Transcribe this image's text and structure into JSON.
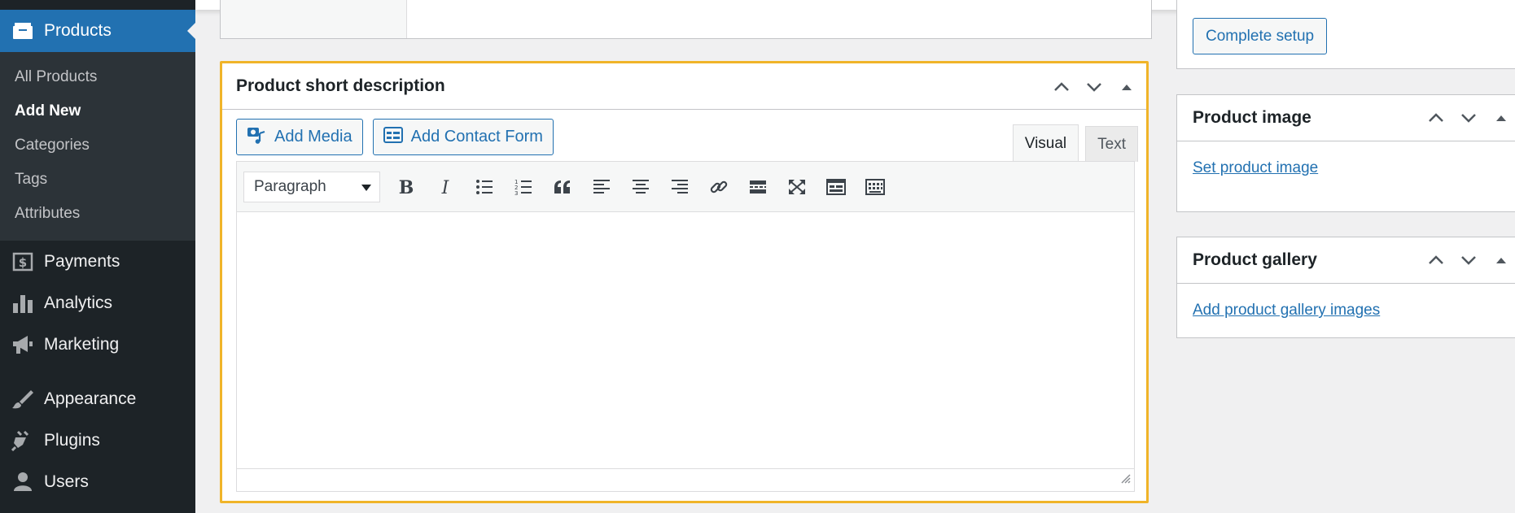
{
  "sidebar": {
    "products_label": "Products",
    "submenu": [
      {
        "label": "All Products",
        "current": false
      },
      {
        "label": "Add New",
        "current": true
      },
      {
        "label": "Categories",
        "current": false
      },
      {
        "label": "Tags",
        "current": false
      },
      {
        "label": "Attributes",
        "current": false
      }
    ],
    "menu": [
      {
        "label": "Payments",
        "icon": "payments-icon"
      },
      {
        "label": "Analytics",
        "icon": "analytics-icon"
      },
      {
        "label": "Marketing",
        "icon": "megaphone-icon"
      },
      {
        "label": "Appearance",
        "icon": "paintbrush-icon"
      },
      {
        "label": "Plugins",
        "icon": "plugin-icon"
      },
      {
        "label": "Users",
        "icon": "users-icon"
      }
    ]
  },
  "short_description": {
    "title": "Product short description",
    "add_media_label": "Add Media",
    "add_contact_form_label": "Add Contact Form",
    "tab_visual": "Visual",
    "tab_text": "Text",
    "format_value": "Paragraph",
    "content": ""
  },
  "right_column": {
    "complete_setup_label": "Complete setup",
    "product_image": {
      "title": "Product image",
      "link": "Set product image"
    },
    "product_gallery": {
      "title": "Product gallery",
      "link": "Add product gallery images"
    }
  },
  "colors": {
    "sidebar_bg": "#1d2327",
    "submenu_bg": "#2c3338",
    "accent": "#2271b1",
    "highlight_border": "#f0b429",
    "page_bg": "#f0f0f1"
  }
}
